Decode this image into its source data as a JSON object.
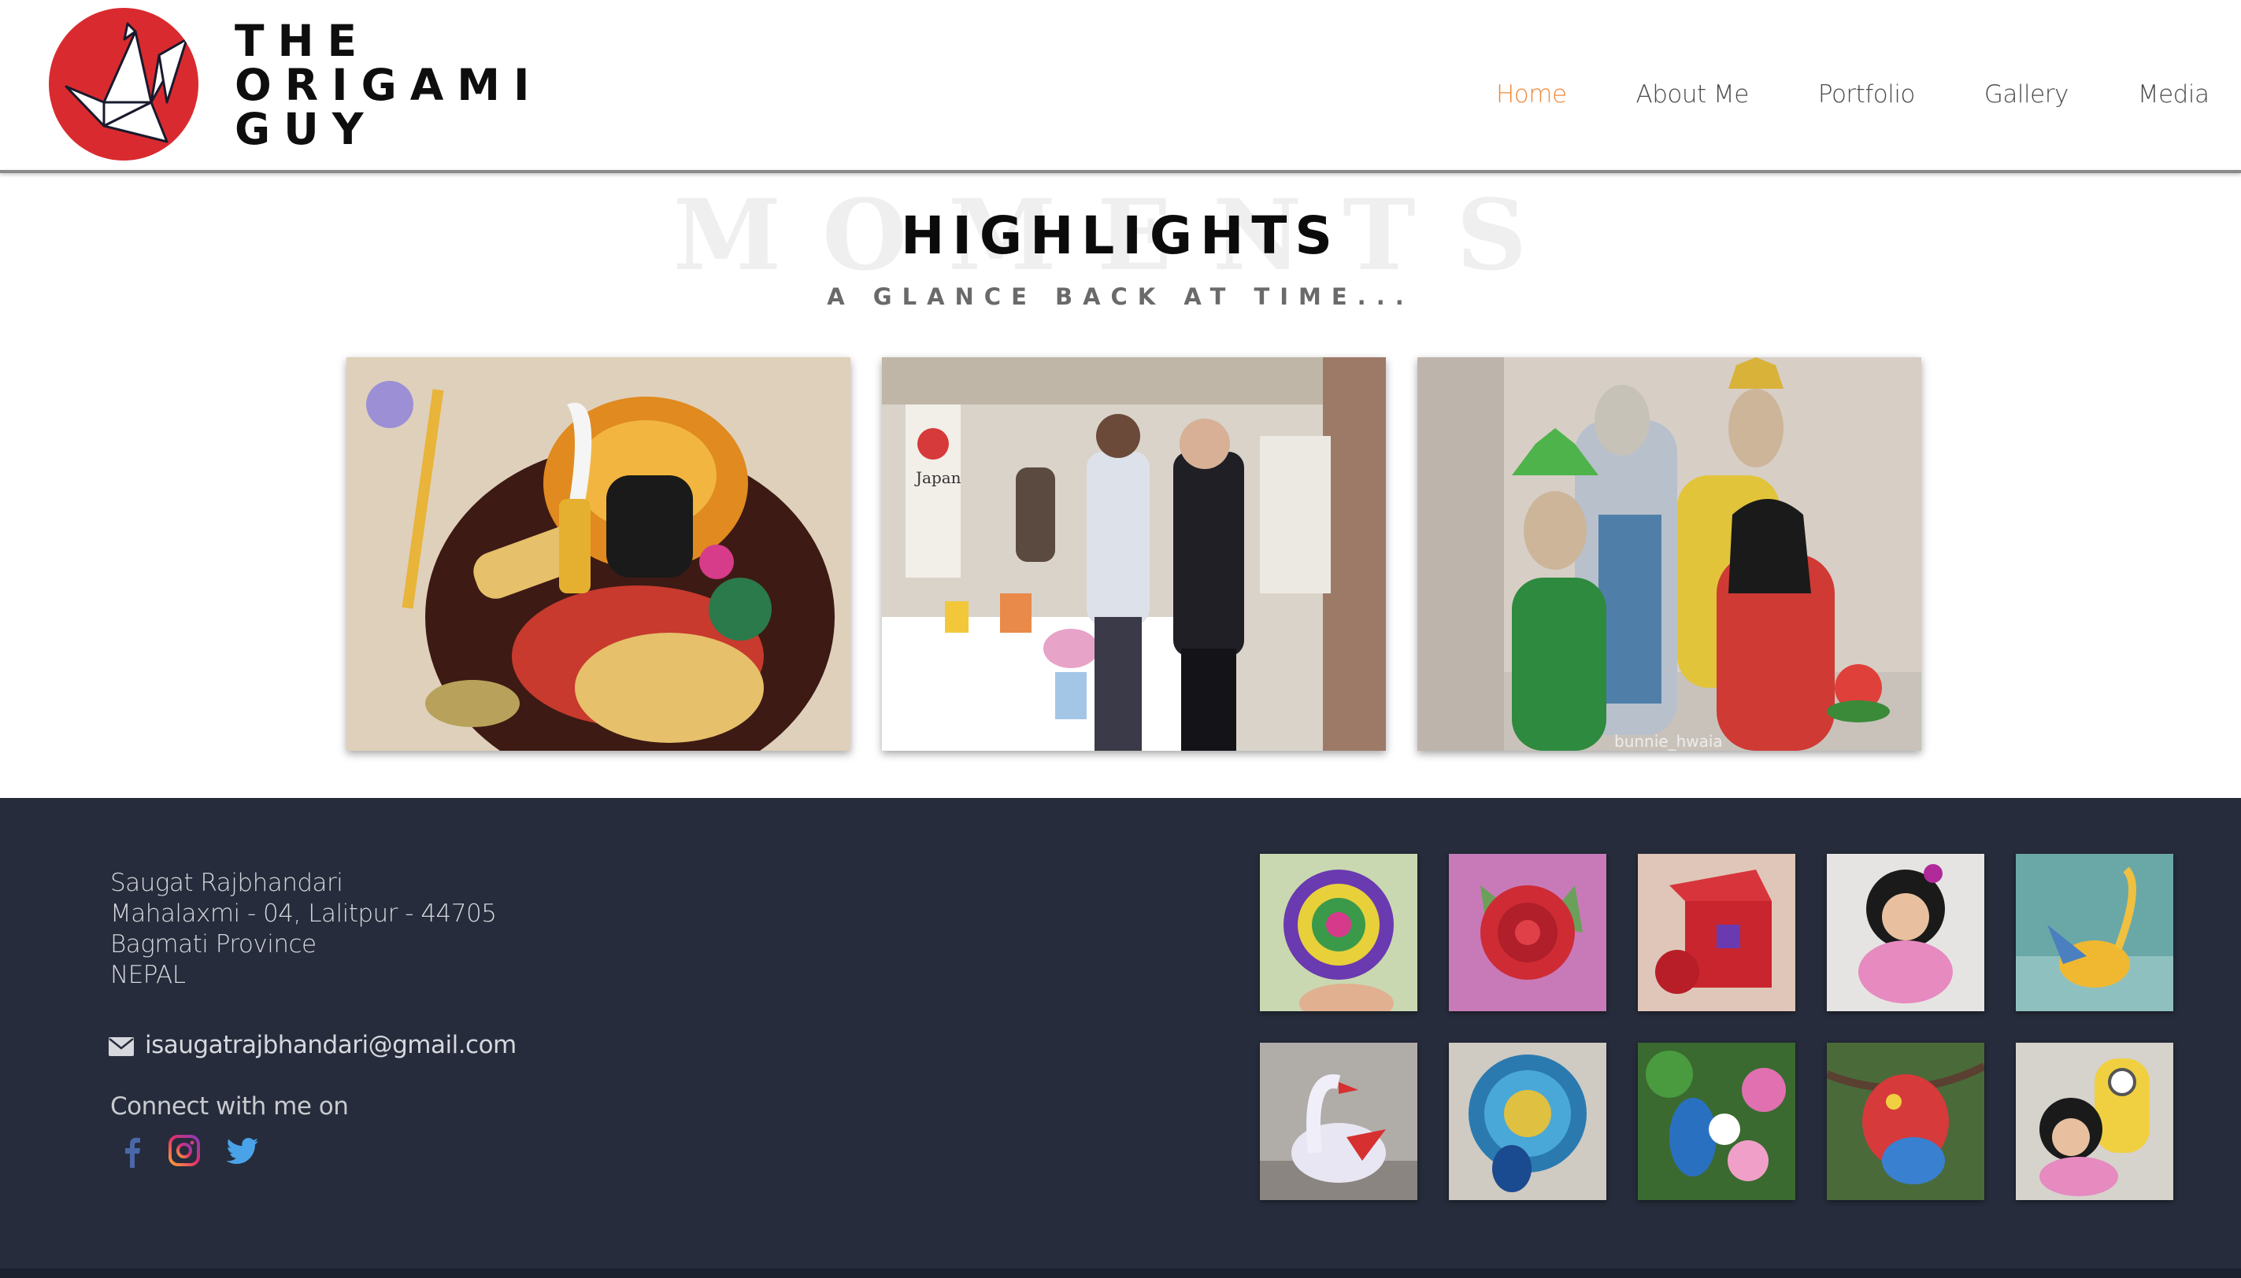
{
  "brand": {
    "logo_lines": [
      "THE",
      "ORIGAMI",
      "GUY"
    ],
    "logo_color": "#d92b2f"
  },
  "nav": {
    "items": [
      {
        "label": "Home",
        "active": true
      },
      {
        "label": "About Me",
        "active": false
      },
      {
        "label": "Portfolio",
        "active": false
      },
      {
        "label": "Gallery",
        "active": false
      },
      {
        "label": "Media",
        "active": false
      }
    ],
    "active_color": "#f0883a"
  },
  "highlights": {
    "background_word": "MOMENTS",
    "title": "HIGHLIGHTS",
    "subtitle": "A GLANCE BACK AT TIME...",
    "photos": [
      {
        "icon": "origami-deity-photo"
      },
      {
        "icon": "exhibition-japan-photo",
        "sign_text": "Japan"
      },
      {
        "icon": "origami-figures-photo",
        "watermark": "bunnie_hwaia"
      }
    ]
  },
  "footer": {
    "background": "#262c3b",
    "address_lines": [
      "Saugat Rajbhandari",
      "Mahalaxmi - 04, Lalitpur - 44705",
      "Bagmati Province",
      "NEPAL"
    ],
    "email": "isaugatrajbhandari@gmail.com",
    "connect_label": "Connect with me on",
    "social": [
      {
        "icon": "facebook-icon",
        "color": "#4a67a8"
      },
      {
        "icon": "instagram-icon",
        "color": "#e1306c"
      },
      {
        "icon": "twitter-icon",
        "color": "#4aa3e8"
      }
    ],
    "gallery_thumbs": [
      "origami-mandala-thumb",
      "paper-rose-thumb",
      "rose-gift-box-thumb",
      "origami-doll-thumb",
      "golden-phoenix-thumb",
      "origami-swan-thumb",
      "blue-peacock-thumb",
      "peacock-flowers-thumb",
      "origami-parrot-thumb",
      "minion-figures-thumb"
    ]
  }
}
